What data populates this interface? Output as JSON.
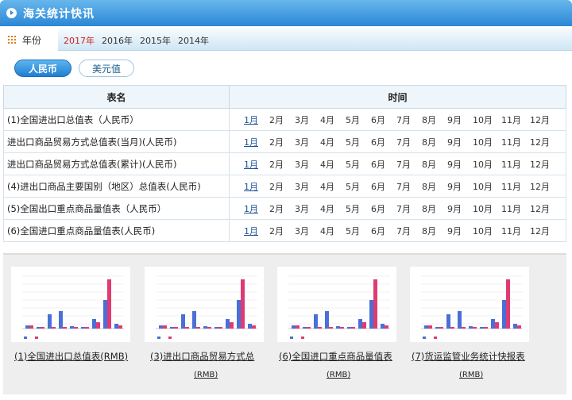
{
  "header": {
    "title": "海关统计快讯",
    "icon": "play-circle-icon"
  },
  "year_bar": {
    "label": "年份",
    "years": [
      {
        "label": "2017年",
        "active": true
      },
      {
        "label": "2016年",
        "active": false
      },
      {
        "label": "2015年",
        "active": false
      },
      {
        "label": "2014年",
        "active": false
      }
    ]
  },
  "currency": {
    "rmb": "人民币",
    "usd": "美元值",
    "selected": "rmb"
  },
  "table": {
    "col_name": "表名",
    "col_time": "时间",
    "rows": [
      {
        "name": "(1)全国进出口总值表（人民币）"
      },
      {
        "name": "进出口商品贸易方式总值表(当月)(人民币)"
      },
      {
        "name": "进出口商品贸易方式总值表(累计)(人民币)"
      },
      {
        "name": "(4)进出口商品主要国别（地区）总值表(人民币)"
      },
      {
        "name": "(5)全国出口重点商品量值表（人民币）"
      },
      {
        "name": "(6)全国进口重点商品量值表(人民币)"
      }
    ],
    "months": [
      "1月",
      "2月",
      "3月",
      "4月",
      "5月",
      "6月",
      "7月",
      "8月",
      "9月",
      "10月",
      "11月",
      "12月"
    ]
  },
  "thumbnails": [
    {
      "caption": "(1)全国进出口总值表(RMB)",
      "sub": ""
    },
    {
      "caption": "(3)进出口商品贸易方式总",
      "sub": "(RMB)"
    },
    {
      "caption": "(6)全国进口重点商品量值表",
      "sub": "(RMB)"
    },
    {
      "caption": "(7)货运监管业务统计快报表",
      "sub": "(RMB)"
    }
  ],
  "colors": {
    "accent": "#2b87d6",
    "active_year": "#d61d1d",
    "bar_blue": "#4a6fd6",
    "bar_pink": "#e03a73"
  }
}
